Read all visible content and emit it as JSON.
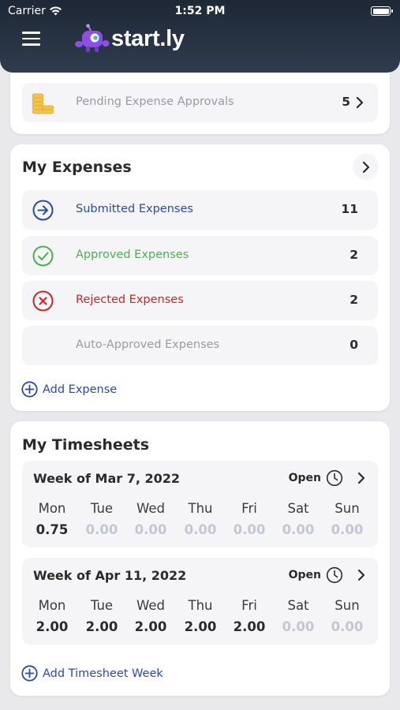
{
  "status_bar": {
    "carrier": "Carrier",
    "time": "1:52 PM"
  },
  "header": {
    "brand": "start.ly",
    "menu_icon": "hamburger-icon"
  },
  "pending": {
    "label": "Pending Expense Approvals",
    "count": "5",
    "icon": "coins-icon"
  },
  "expenses": {
    "title": "My Expenses",
    "rows": [
      {
        "label": "Submitted Expenses",
        "count": "11",
        "color": "#2b4aa8",
        "icon": "arrow-right-circle-icon"
      },
      {
        "label": "Approved Expenses",
        "count": "2",
        "color": "#4caf50",
        "icon": "check-circle-icon"
      },
      {
        "label": "Rejected Expenses",
        "count": "2",
        "color": "#c62828",
        "icon": "x-circle-icon"
      },
      {
        "label": "Auto-Approved Expenses",
        "count": "0",
        "color": "#9a9aa0",
        "icon": ""
      }
    ],
    "add_label": "Add Expense"
  },
  "timesheets": {
    "title": "My Timesheets",
    "day_names": [
      "Mon",
      "Tue",
      "Wed",
      "Thu",
      "Fri",
      "Sat",
      "Sun"
    ],
    "weeks": [
      {
        "title": "Week of Mar 7, 2022",
        "status": "Open",
        "values": [
          "0.75",
          "0.00",
          "0.00",
          "0.00",
          "0.00",
          "0.00",
          "0.00"
        ]
      },
      {
        "title": "Week of Apr 11, 2022",
        "status": "Open",
        "values": [
          "2.00",
          "2.00",
          "2.00",
          "2.00",
          "2.00",
          "0.00",
          "0.00"
        ]
      }
    ],
    "add_label": "Add Timesheet Week"
  },
  "colors": {
    "accent": "#2b4aa8",
    "header_dark": "#1e2836",
    "zero_value": "#c4c6d2"
  }
}
